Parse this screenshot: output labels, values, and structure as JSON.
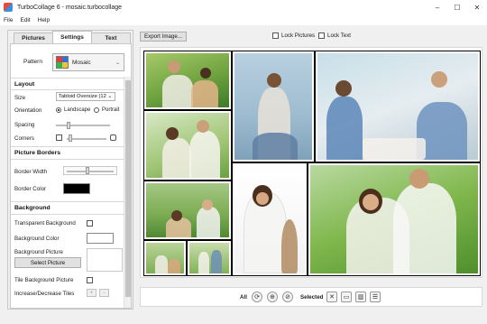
{
  "window": {
    "title": "TurboCollage 6 - mosaic.turbocollage",
    "minimize": "–",
    "maximize": "☐",
    "close": "✕"
  },
  "menu": [
    "File",
    "Edit",
    "Help"
  ],
  "tabs": [
    "Pictures",
    "Settings",
    "Text"
  ],
  "pattern": {
    "label": "Pattern",
    "value": "Mosaic",
    "chevron": "⌄"
  },
  "layout": {
    "header": "Layout",
    "size_label": "Size",
    "size_value": "Tabloid Oversize (12 ⌄",
    "orientation_label": "Orientation",
    "landscape": "Landscape",
    "portrait": "Portrait",
    "spacing_label": "Spacing",
    "corners_label": "Corners"
  },
  "borders": {
    "header": "Picture Borders",
    "width_label": "Border Width",
    "color_label": "Border Color",
    "color": "#000000"
  },
  "background": {
    "header": "Background",
    "transparent_label": "Transparent Background",
    "color_label": "Background Color",
    "color": "#ffffff",
    "picture_label": "Background Picture",
    "select_button": "Select Picture",
    "tile_label": "Tile Background Picture",
    "tiles_label": "Increase/Decrease Tiles",
    "plus": "+",
    "minus": "-"
  },
  "toolbar": {
    "export": "Export Image...",
    "lock_pictures": "Lock Pictures",
    "lock_text": "Lock Text"
  },
  "bottom": {
    "all_label": "All",
    "selected_label": "Selected"
  },
  "colors": {
    "accent_green": "#4a9a3a",
    "collage_border": "#000000"
  }
}
